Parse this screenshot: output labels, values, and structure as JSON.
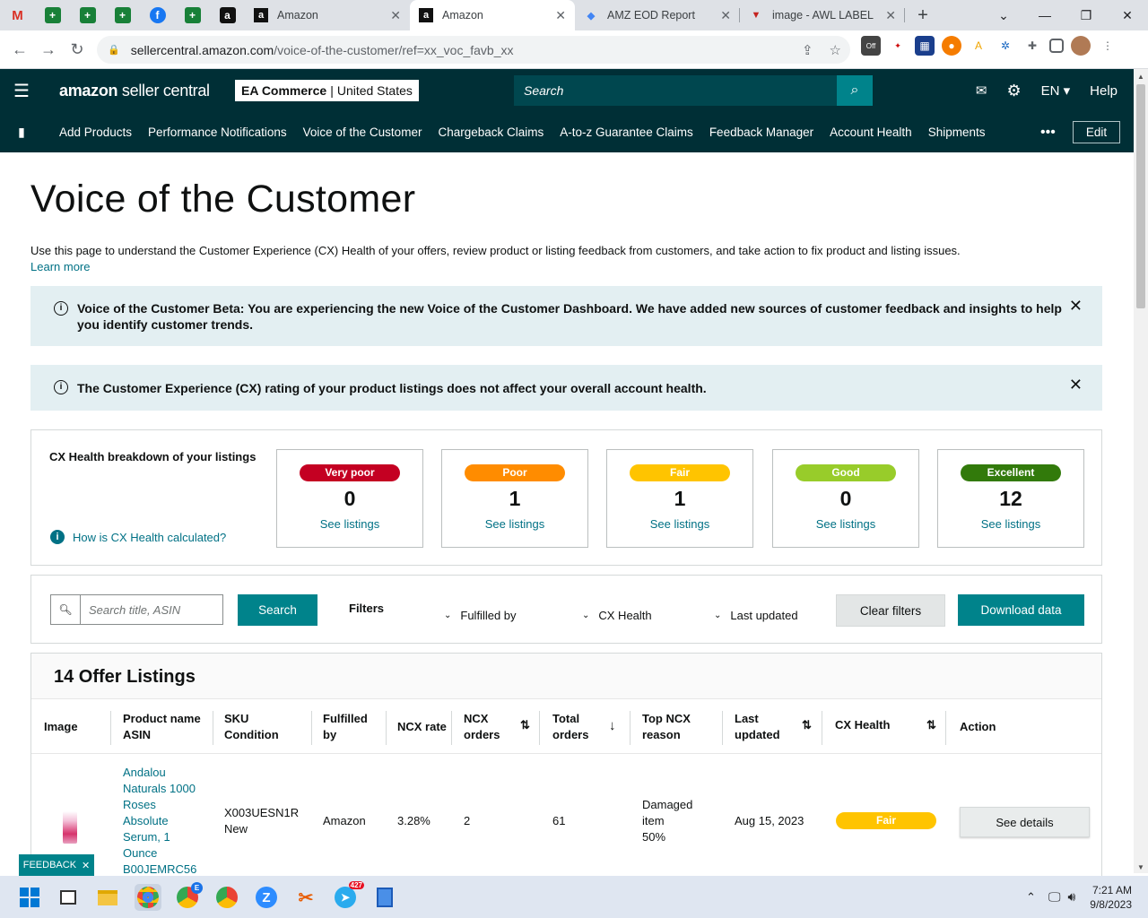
{
  "browser": {
    "tabs": [
      {
        "title": "Amazon",
        "icon": "amazon-icon"
      },
      {
        "title": "Amazon",
        "icon": "amazon-icon",
        "active": true
      },
      {
        "title": "AMZ EOD Report",
        "icon": "report-icon"
      },
      {
        "title": "image - AWL LABEL",
        "icon": "awl-icon"
      }
    ],
    "url_host": "sellercentral.amazon.com",
    "url_path": "/voice-of-the-customer/ref=xx_voc_favb_xx",
    "extension_badge": "Off"
  },
  "header": {
    "logo_bold": "amazon",
    "logo_rest": " seller central",
    "account_name": "EA Commerce",
    "account_sep": "|",
    "account_region": "United States",
    "search_placeholder": "Search",
    "language": "EN",
    "help": "Help"
  },
  "nav": {
    "items": [
      "Add Products",
      "Performance Notifications",
      "Voice of the Customer",
      "Chargeback Claims",
      "A-to-z Guarantee Claims",
      "Feedback Manager",
      "Account Health",
      "Shipments"
    ],
    "more": "•••",
    "edit": "Edit"
  },
  "page": {
    "title": "Voice of the Customer",
    "intro": "Use this page to understand the Customer Experience (CX) Health of your offers, review product or listing feedback from customers, and take action to fix product and listing issues.",
    "learn_more": "Learn more"
  },
  "alerts": [
    {
      "text": "Voice of the Customer Beta: You are experiencing the new Voice of the Customer Dashboard. We have added new sources of customer feedback and insights to help you identify customer trends."
    },
    {
      "text": "The Customer Experience (CX) rating of your product listings does not affect your overall account health."
    }
  ],
  "cx_health": {
    "title": "CX Health breakdown of your listings",
    "how_link": "How is CX Health calculated?",
    "cards": [
      {
        "label": "Very poor",
        "count": "0",
        "link": "See listings",
        "color": "#c40022"
      },
      {
        "label": "Poor",
        "count": "1",
        "link": "See listings",
        "color": "#ff8c00"
      },
      {
        "label": "Fair",
        "count": "1",
        "link": "See listings",
        "color": "#ffc400"
      },
      {
        "label": "Good",
        "count": "0",
        "link": "See listings",
        "color": "#98cc2a"
      },
      {
        "label": "Excellent",
        "count": "12",
        "link": "See listings",
        "color": "#327a0b"
      }
    ]
  },
  "filters": {
    "search_placeholder": "Search title, ASIN",
    "search_button": "Search",
    "filters_label": "Filters",
    "dropdowns": [
      "Fulfilled by",
      "CX Health",
      "Last updated"
    ],
    "clear": "Clear filters",
    "download": "Download data"
  },
  "table": {
    "title": "14 Offer Listings",
    "columns": {
      "image": "Image",
      "product_1": "Product name",
      "product_2": "ASIN",
      "sku_1": "SKU",
      "sku_2": "Condition",
      "ful_1": "Fulfilled",
      "ful_2": "by",
      "ncx_rate": "NCX rate",
      "ncx_orders_1": "NCX",
      "ncx_orders_2": "orders",
      "total_1": "Total",
      "total_2": "orders",
      "top_1": "Top NCX",
      "top_2": "reason",
      "last_1": "Last",
      "last_2": "updated",
      "cx_health": "CX Health",
      "action": "Action"
    },
    "row": {
      "product_lines": [
        "Andalou",
        "Naturals 1000",
        "Roses",
        "Absolute",
        "Serum, 1",
        "Ounce",
        "B00JEMRC56"
      ],
      "sku": "X003UESN1R",
      "condition": "New",
      "fulfilled_by": "Amazon",
      "ncx_rate": "3.28%",
      "ncx_orders": "2",
      "total_orders": "61",
      "top_reason_1": "Damaged",
      "top_reason_2": "item",
      "top_reason_3": "50%",
      "last_updated": "Aug 15, 2023",
      "cx_health": "Fair",
      "action": "See details"
    }
  },
  "feedback_tab": "FEEDBACK",
  "taskbar": {
    "badge_count": "427",
    "badge_letter": "E",
    "time": "7:21 AM",
    "date": "9/8/2023"
  }
}
